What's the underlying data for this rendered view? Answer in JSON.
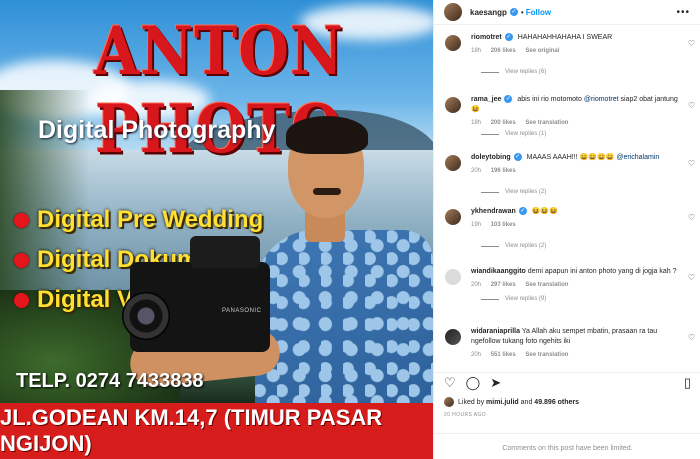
{
  "ad": {
    "brand": "ANTON PHOTO",
    "subtitle": "Digital Photography",
    "services": [
      "Digital Pre Wedding",
      "Digital Dokumenter",
      "Digital Video Art"
    ],
    "phone": "TELP. 0274 7433838",
    "address": "JL.GODEAN KM.14,7 (TIMUR PASAR NGIJON)",
    "camera_mark": "PANASONIC",
    "colors": {
      "brand_red": "#d8171c",
      "service_yellow": "#ffe033",
      "address_bar": "#d71d1b"
    }
  },
  "post": {
    "author": "kaesangp",
    "follow_label": "Follow",
    "more_icon": "more-icon",
    "comments": [
      {
        "user": "riomotret",
        "verified": true,
        "text": "HAHAHAHHAHAHA I SWEAR",
        "time": "18h",
        "likes": "206 likes",
        "action": "See original",
        "replies": "View replies (6)"
      },
      {
        "user": "rama_jee",
        "verified": true,
        "text_before": "abis ini rio motomoto ",
        "mention": "@riomotret",
        "text_after": " siap2 obat jantung😆",
        "time": "18h",
        "likes": "200 likes",
        "action": "See translation",
        "replies": "View replies (1)"
      },
      {
        "user": "doleytobing",
        "verified": true,
        "text_before": "MAAAS AAAH!!! 😄😄😄😄 ",
        "mention": "@erichalamin",
        "text_after": "",
        "time": "20h",
        "likes": "196 likes",
        "action": "",
        "replies": "View replies (2)"
      },
      {
        "user": "ykhendrawan",
        "verified": true,
        "text": "😆😆😆",
        "time": "19h",
        "likes": "103 likes",
        "action": "",
        "replies": "View replies (2)"
      },
      {
        "user": "wiandikaanggito",
        "verified": false,
        "text": "demi apapun ini anton photo yang di jogja kah ?",
        "time": "20h",
        "likes": "297 likes",
        "action": "See translation",
        "replies": "View replies (9)"
      },
      {
        "user": "widaraniaprilla",
        "verified": false,
        "text": "Ya Allah aku sempet mbatin, prasaan ra tau ngefollow tukang foto ngehits iki",
        "time": "20h",
        "likes": "551 likes",
        "action": "See translation",
        "replies": ""
      }
    ],
    "likes_prefix": "Liked by ",
    "liked_by": "mimi.julid",
    "likes_join": " and ",
    "likes_count": "49.896 others",
    "posted_time": "20 HOURS AGO",
    "limited_notice": "Comments on this post have been limited."
  }
}
